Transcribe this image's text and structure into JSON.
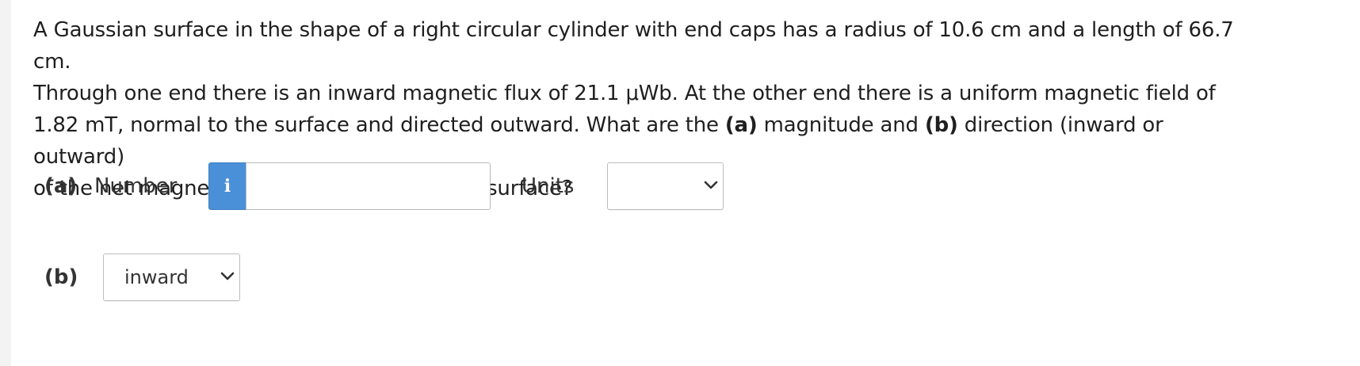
{
  "question": {
    "line1": "A Gaussian surface in the shape of a right circular cylinder with end caps has a radius of 10.6 cm and a length of 66.7 cm.",
    "line2": "Through one end there is an inward magnetic flux of 21.1 μWb. At the other end there is a uniform magnetic field of",
    "line3_pre": "1.82 mT, normal to the surface and directed outward. What are the ",
    "line3_a": "(a)",
    "line3_mid": " magnitude and ",
    "line3_b": "(b)",
    "line3_post": " direction (inward or outward)",
    "line4": "of the net magnetic flux through the curved surface?"
  },
  "part_a": {
    "label": "(a)",
    "number_label": "Number",
    "info_icon": "i",
    "number_value": "",
    "units_label": "Units",
    "units_selected": ""
  },
  "part_b": {
    "label": "(b)",
    "selected": "inward"
  },
  "colors": {
    "info_button": "#4a90d9",
    "sidebar": "#f3f3f3"
  }
}
